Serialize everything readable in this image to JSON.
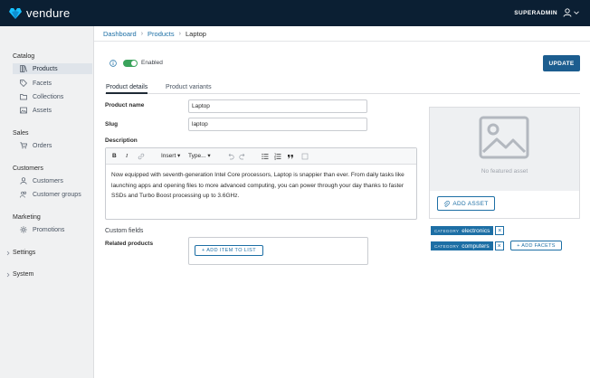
{
  "app": {
    "name": "vendure",
    "user": "SUPERADMIN",
    "accent_color": "#1d6fa5",
    "topbar_color": "#0b1f33"
  },
  "sidebar": {
    "sections": [
      {
        "title": "Catalog",
        "items": [
          {
            "label": "Products",
            "icon": "products-icon"
          },
          {
            "label": "Facets",
            "icon": "tag-icon"
          },
          {
            "label": "Collections",
            "icon": "folder-icon"
          },
          {
            "label": "Assets",
            "icon": "image-icon"
          }
        ]
      },
      {
        "title": "Sales",
        "items": [
          {
            "label": "Orders",
            "icon": "cart-icon"
          }
        ]
      },
      {
        "title": "Customers",
        "items": [
          {
            "label": "Customers",
            "icon": "user-icon"
          },
          {
            "label": "Customer groups",
            "icon": "users-icon"
          }
        ]
      },
      {
        "title": "Marketing",
        "items": [
          {
            "label": "Promotions",
            "icon": "gear-icon"
          }
        ]
      }
    ],
    "collapsibles": [
      "Settings",
      "System"
    ],
    "active_item": "Products"
  },
  "breadcrumb": [
    "Dashboard",
    "Products",
    "Laptop"
  ],
  "header": {
    "enabled_label": "Enabled",
    "enabled": true,
    "update_label": "UPDATE"
  },
  "tabs": [
    {
      "label": "Product details",
      "active": true
    },
    {
      "label": "Product variants",
      "active": false
    }
  ],
  "form": {
    "product_name_label": "Product name",
    "product_name_value": "Laptop",
    "slug_label": "Slug",
    "slug_value": "laptop",
    "description_label": "Description",
    "description_value": "Now equipped with seventh-generation Intel Core processors, Laptop is snappier than ever. From daily tasks like launching apps and opening files to more advanced computing, you can power through your day thanks to faster SSDs and Turbo Boost processing up to 3.6GHz.",
    "custom_fields_label": "Custom fields",
    "related_products_label": "Related products",
    "add_item_label": "+ ADD ITEM TO LIST"
  },
  "editor_toolbar": {
    "bold": "B",
    "italic": "I",
    "insert": "Insert ▾",
    "type": "Type... ▾"
  },
  "assets": {
    "no_asset_text": "No featured asset",
    "add_asset_label": "ADD ASSET"
  },
  "facets": [
    {
      "category": "CATEGORY",
      "value": "electronics"
    },
    {
      "category": "CATEGORY",
      "value": "computers"
    }
  ],
  "add_facets_label": "+ ADD FACETS"
}
